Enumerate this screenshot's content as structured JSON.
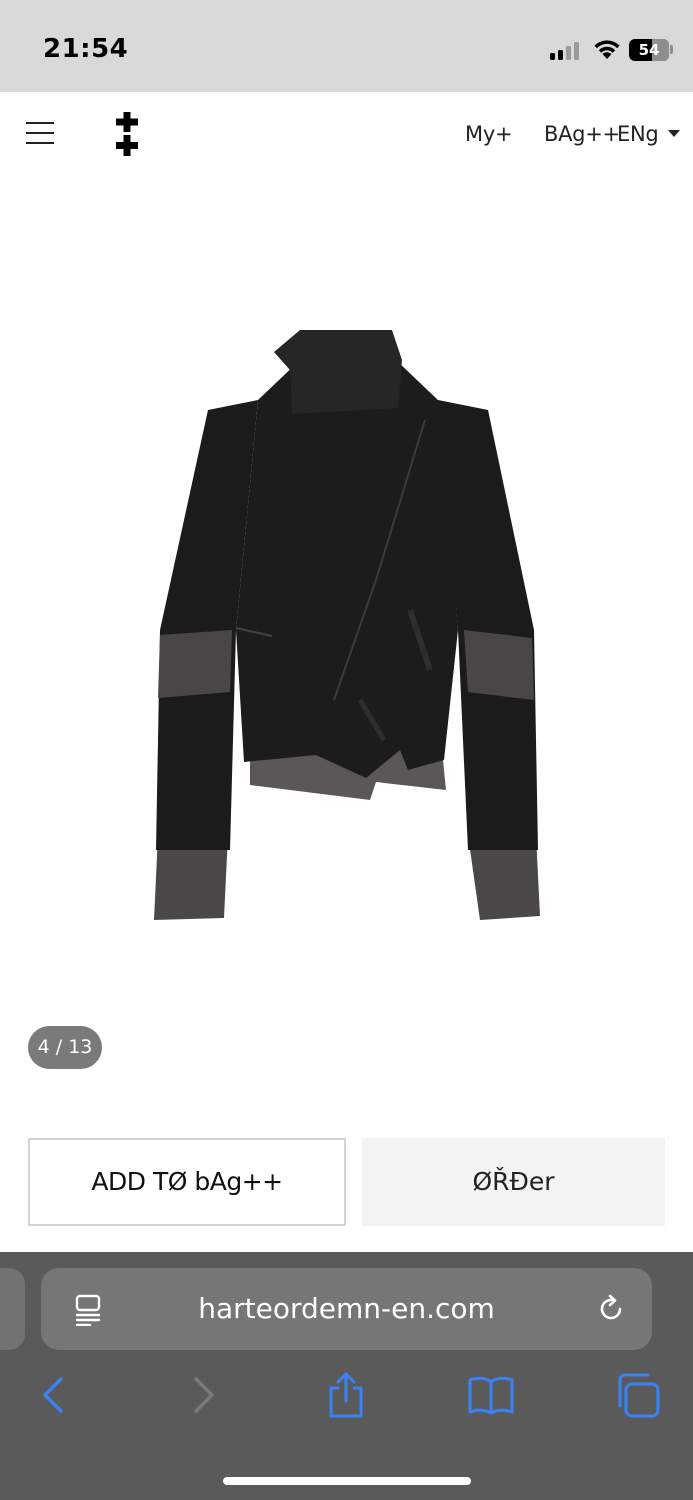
{
  "status_bar": {
    "time": "21:54",
    "battery": "54"
  },
  "header": {
    "my_label": "My+",
    "bag_label": "BAg++",
    "language": "ENg"
  },
  "product": {
    "image_counter": "4 / 13"
  },
  "actions": {
    "add_to_bag": "ADD TØ bAg++",
    "order": "ØŘĐer"
  },
  "browser": {
    "url": "harteordemn-en.com"
  },
  "colors": {
    "status_bar_bg": "#d9d9d9",
    "toolbar_bg": "#5a5a5a",
    "url_bar_bg": "#767676",
    "safari_blue": "#3b82f6",
    "counter_bg": "#7a7a7a"
  }
}
